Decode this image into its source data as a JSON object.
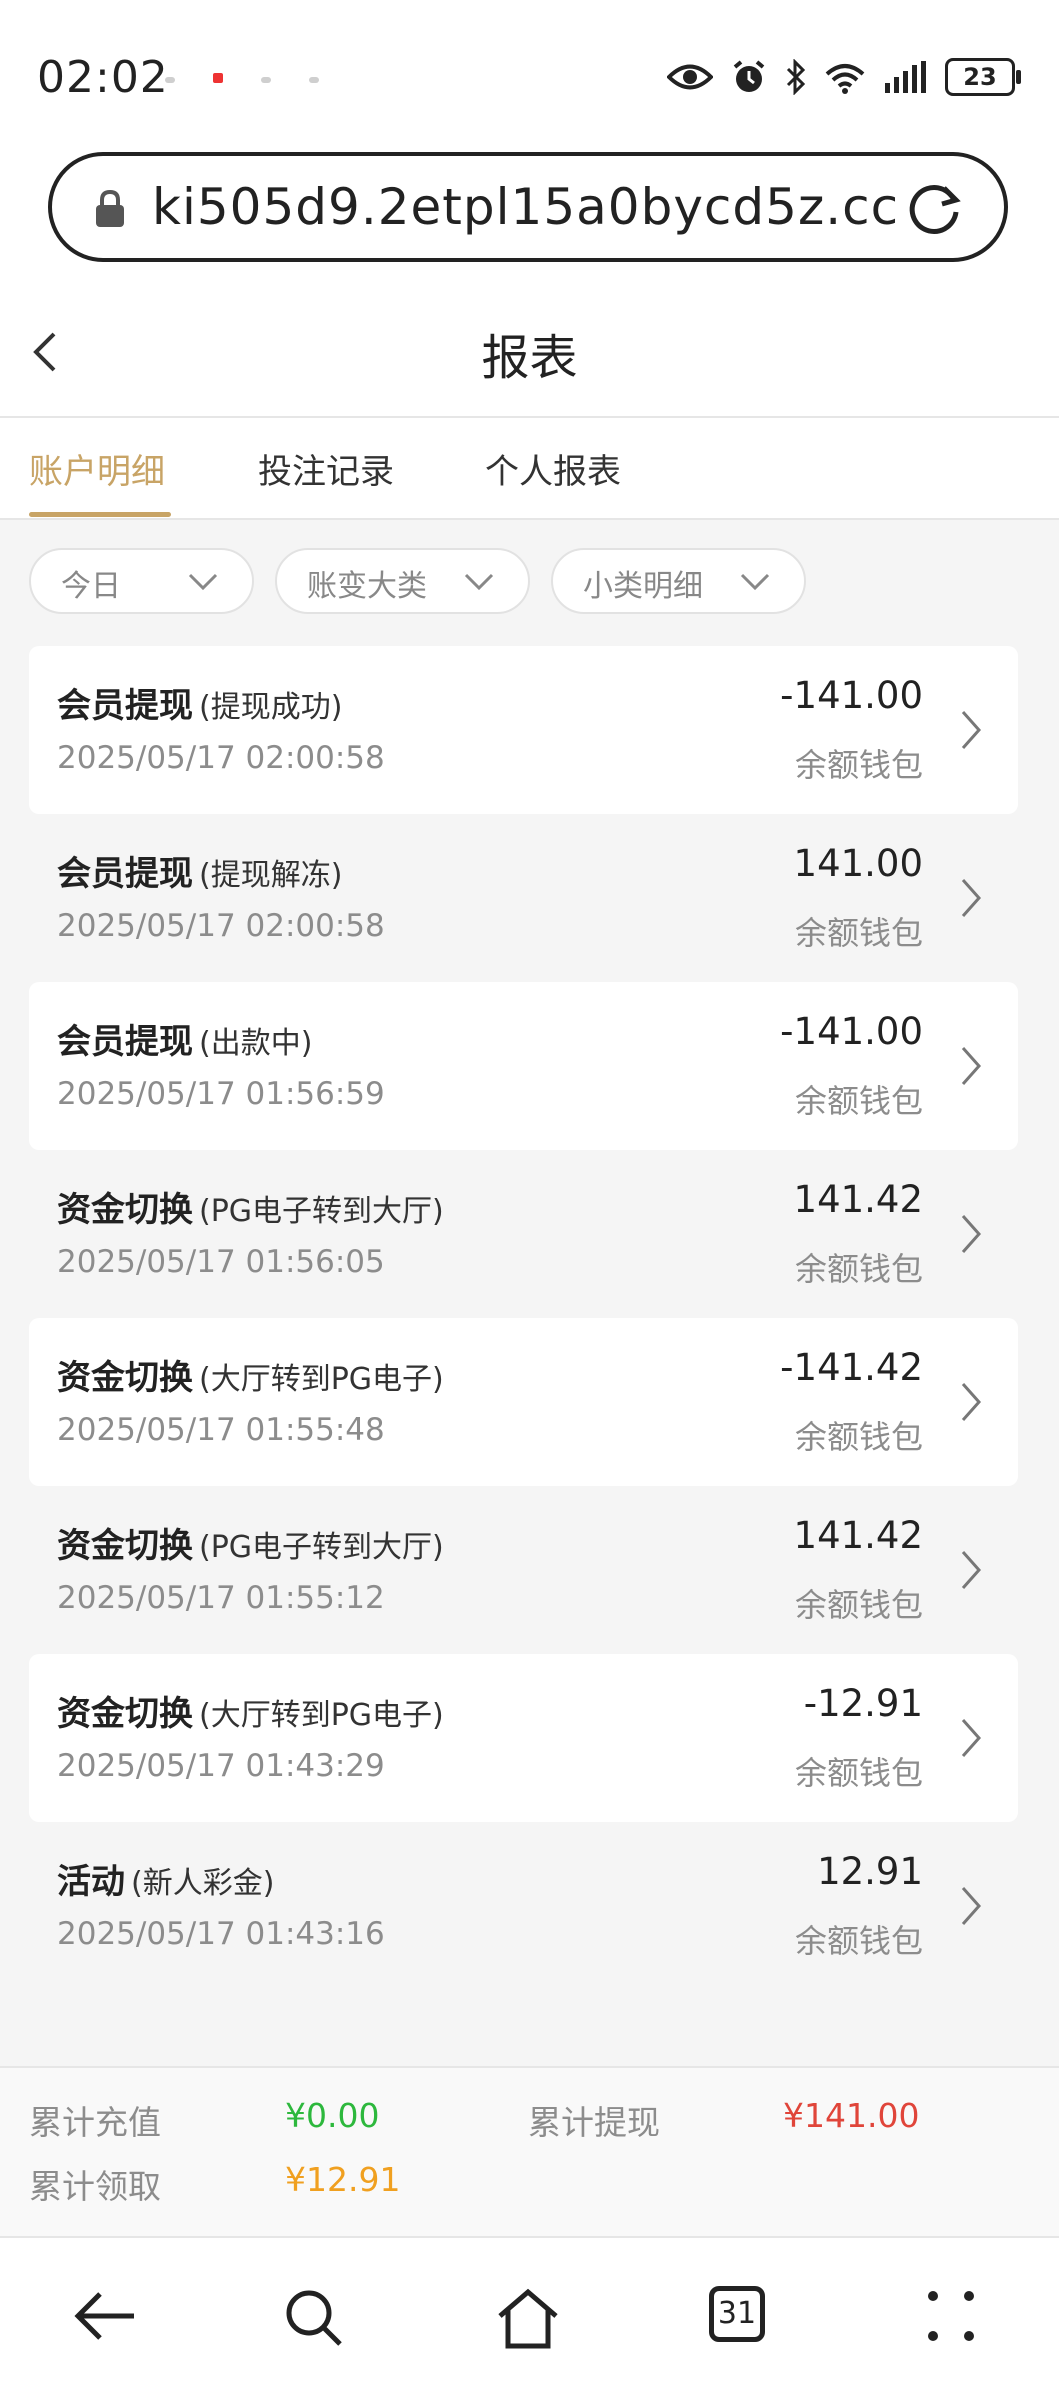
{
  "status": {
    "time": "02:02",
    "battery": "23"
  },
  "browser": {
    "url": "ki505d9.2etpl15a0bycd5z.cc"
  },
  "header": {
    "title": "报表"
  },
  "tabs": [
    {
      "label": "账户明细",
      "active": true
    },
    {
      "label": "投注记录",
      "active": false
    },
    {
      "label": "个人报表",
      "active": false
    }
  ],
  "filters": [
    {
      "label": "今日"
    },
    {
      "label": "账变大类"
    },
    {
      "label": "小类明细"
    }
  ],
  "records": [
    {
      "type": "会员提现",
      "detail": "(提现成功)",
      "time": "2025/05/17 02:00:58",
      "amount": "-141.00",
      "wallet": "余额钱包"
    },
    {
      "type": "会员提现",
      "detail": "(提现解冻)",
      "time": "2025/05/17 02:00:58",
      "amount": "141.00",
      "wallet": "余额钱包"
    },
    {
      "type": "会员提现",
      "detail": "(出款中)",
      "time": "2025/05/17 01:56:59",
      "amount": "-141.00",
      "wallet": "余额钱包"
    },
    {
      "type": "资金切换",
      "detail": "(PG电子转到大厅)",
      "time": "2025/05/17 01:56:05",
      "amount": "141.42",
      "wallet": "余额钱包"
    },
    {
      "type": "资金切换",
      "detail": "(大厅转到PG电子)",
      "time": "2025/05/17 01:55:48",
      "amount": "-141.42",
      "wallet": "余额钱包"
    },
    {
      "type": "资金切换",
      "detail": "(PG电子转到大厅)",
      "time": "2025/05/17 01:55:12",
      "amount": "141.42",
      "wallet": "余额钱包"
    },
    {
      "type": "资金切换",
      "detail": "(大厅转到PG电子)",
      "time": "2025/05/17 01:43:29",
      "amount": "-12.91",
      "wallet": "余额钱包"
    },
    {
      "type": "活动",
      "detail": "(新人彩金)",
      "time": "2025/05/17 01:43:16",
      "amount": "12.91",
      "wallet": "余额钱包"
    }
  ],
  "summary": {
    "recharge_label": "累计充值",
    "recharge_value": "¥0.00",
    "withdraw_label": "累计提现",
    "withdraw_value": "¥141.00",
    "claim_label": "累计领取",
    "claim_value": "¥12.91"
  },
  "colors": {
    "accent": "#c8a466",
    "green": "#2db83d",
    "red": "#e0453a",
    "orange": "#f0a020"
  },
  "bottom_nav": {
    "tabs_count": "31"
  }
}
